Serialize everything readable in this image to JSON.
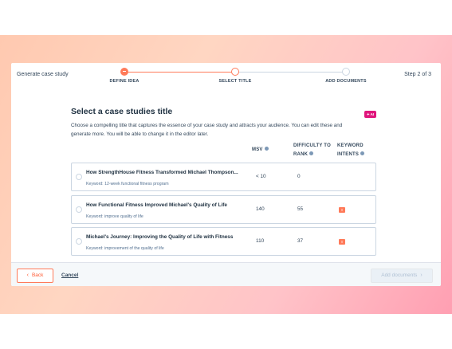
{
  "header": {
    "wizard_title": "Generate case study",
    "step_indicator": "Step 2 of 3",
    "steps": [
      {
        "label": "DEFINE IDEA",
        "state": "complete"
      },
      {
        "label": "SELECT TITLE",
        "state": "current"
      },
      {
        "label": "ADD DOCUMENTS",
        "state": "upcoming"
      }
    ]
  },
  "main": {
    "title": "Select a case studies title",
    "ai_badge": "✦ AI",
    "description": "Choose a compelling title that captures the essence of your case study and attracts your audience. You can edit these and generate more. You will be able to change it in the editor later.",
    "columns": {
      "msv": "MSV",
      "difficulty": "DIFFICULTY TO RANK",
      "intents": "KEYWORD INTENTS"
    },
    "rows": [
      {
        "title": "How StrengthHouse Fitness Transformed Michael Thompson...",
        "keyword": "Keyword: 12-week functional fitness program",
        "msv": "< 10",
        "difficulty": "0",
        "intent": ""
      },
      {
        "title": "How Functional Fitness Improved Michael's Quality of Life",
        "keyword": "Keyword: improve quality of life",
        "msv": "140",
        "difficulty": "55",
        "intent": "I"
      },
      {
        "title": "Michael's Journey: Improving the Quality of Life with Fitness",
        "keyword": "Keyword: improvement of the quality of life",
        "msv": "110",
        "difficulty": "37",
        "intent": "I"
      }
    ]
  },
  "footer": {
    "back_label": "Back",
    "cancel_label": "Cancel",
    "next_label": "Add documents"
  },
  "colors": {
    "accent": "#ff7a59",
    "ai_badge": "#e0157c",
    "text": "#33475b"
  }
}
